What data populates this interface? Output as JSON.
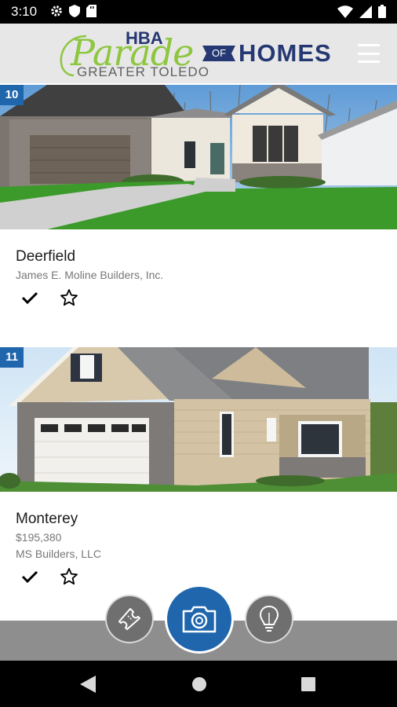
{
  "status_bar": {
    "time": "3:10",
    "left_icons": [
      "gear-icon",
      "shield-icon",
      "sd-card-icon"
    ],
    "right_icons": [
      "wifi-icon",
      "signal-icon",
      "battery-icon"
    ]
  },
  "header": {
    "logo_hba": "HBA",
    "logo_parade": "Parade",
    "logo_of": "OF",
    "logo_homes": "HOMES",
    "logo_sub": "GREATER TOLEDO",
    "colors": {
      "navy": "#253873",
      "green": "#8dc63f",
      "background": "#e7e7e7"
    }
  },
  "listings": [
    {
      "number": "10",
      "name": "Deerfield",
      "lines": [
        "James E. Moline Builders, Inc."
      ],
      "actions": [
        "check-icon",
        "star-outline-icon"
      ]
    },
    {
      "number": "11",
      "name": "Monterey",
      "lines": [
        "$195,380",
        "MS Builders, LLC"
      ],
      "actions": [
        "check-icon",
        "star-outline-icon"
      ]
    }
  ],
  "fab_buttons": [
    {
      "name": "ticket-icon"
    },
    {
      "name": "camera-icon"
    },
    {
      "name": "lightbulb-icon"
    }
  ],
  "accent_color": "#1f66ad",
  "nav_bar": {
    "buttons": [
      "back-icon",
      "home-icon",
      "recents-icon"
    ]
  }
}
